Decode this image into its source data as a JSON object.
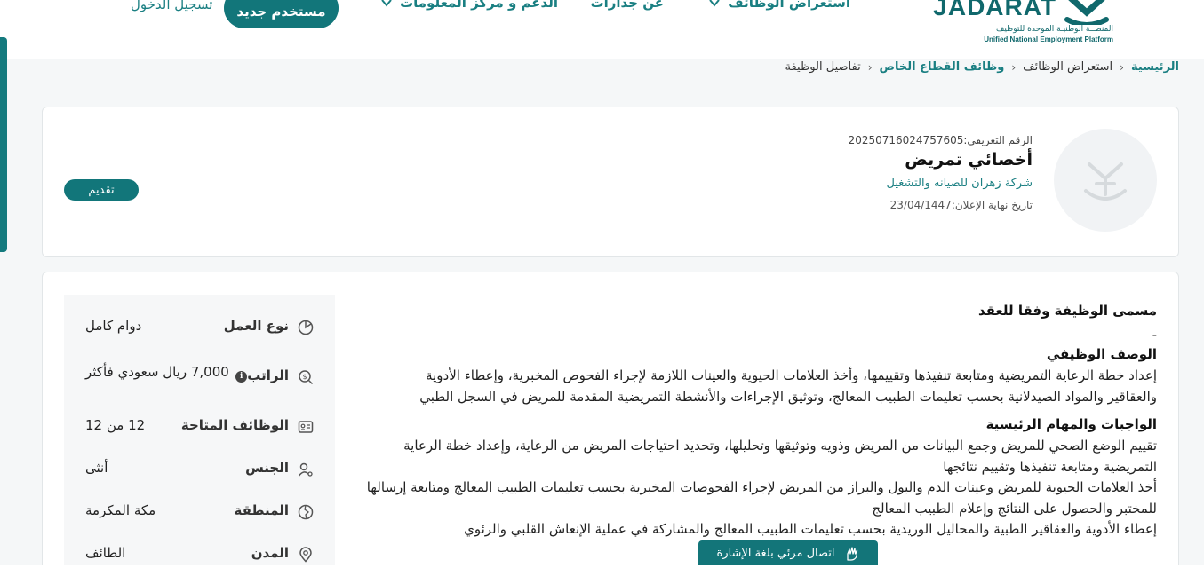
{
  "colors": {
    "primary": "#12767a",
    "link": "#1a7f82",
    "background": "#f5f7f8",
    "card": "#ffffff",
    "side_panel": "#f6f7f8"
  },
  "header": {
    "logo": {
      "word": "JADARAT",
      "arabic": "المنصــة الوطنيـة الموحدة للتوظيف",
      "english": "Unified National Employment Platform"
    },
    "nav": [
      {
        "label": "استعراض الوظائف",
        "has_dropdown": true,
        "icon": "chevron-down-icon"
      },
      {
        "label": "عن جدارات",
        "has_dropdown": false
      },
      {
        "label": "الدعم و مركز المعلومات",
        "has_dropdown": true,
        "icon": "chevron-down-icon"
      }
    ],
    "new_user_button": "مستخدم جديد",
    "login_link": "تسجيل الدخول"
  },
  "breadcrumb": [
    {
      "label": "الرئيسية",
      "link": true
    },
    {
      "label": "استعراض الوظائف",
      "link": false
    },
    {
      "label": "وظائف القطاع الخاص",
      "link": true
    },
    {
      "label": "تفاصيل الوظيفة",
      "link": false
    }
  ],
  "job": {
    "id_label": "الرقم التعريفي:",
    "id_value": "20250716024757605",
    "title": "أخصائي تمريض",
    "company": "شركة زهران للصيانه والتشغيل",
    "deadline_label": "تاريخ نهاية الإعلان:",
    "deadline_value": "23/04/1447",
    "apply_button": "تقديم",
    "logo_icon": "company-placeholder-logo-icon"
  },
  "details": {
    "contract_title_heading": "مسمى الوظيفة وفقا للعقد",
    "contract_title_value": "-",
    "job_description_heading": "الوصف الوظيفي",
    "job_description_lines": [
      "إعداد خطة الرعاية التمريضية ومتابعة تنفيذها وتقييمها، وأخذ العلامات الحيوية والعينات اللازمة لإجراء الفحوص المخبرية، وإعطاء الأدوية",
      "والعقاقير والمواد الصيدلانية بحسب تعليمات الطبيب المعالج، وتوثيق الإجراءات والأنشطة التمريضية المقدمة للمريض في السجل الطبي"
    ],
    "duties_heading": "الواجبات والمهام الرئيسية",
    "duties_lines": [
      "تقييم الوضع الصحي للمريض وجمع البيانات من المريض وذويه وتوثيقها وتحليلها، وتحديد احتياجات المريض من الرعاية، وإعداد خطة الرعاية",
      "التمريضية ومتابعة تنفيذها وتقييم نتائجها",
      "أخذ العلامات الحيوية للمريض وعينات الدم والبول والبراز من المريض لإجراء الفحوصات المخبرية بحسب تعليمات الطبيب المعالج ومتابعة إرسالها",
      "للمختبر والحصول على النتائج وإعلام الطبيب المعالج",
      "إعطاء الأدوية والعقاقير الطبية والمحاليل الوريدية بحسب تعليمات الطبيب المعالج والمشاركة في عملية الإنعاش القلبي والرئوي"
    ]
  },
  "side_info": [
    {
      "icon": "pie-chart-icon",
      "label": "نوع العمل",
      "value": "دوام كامل"
    },
    {
      "icon": "money-search-icon",
      "label": "الراتب",
      "value": "7,000 ريال سعودي فأكثر",
      "info_icon": "info-icon"
    },
    {
      "icon": "id-card-icon",
      "label": "الوظائف المتاحة",
      "value": "12  من 12"
    },
    {
      "icon": "user-gender-icon",
      "label": "الجنس",
      "value": "أنثى"
    },
    {
      "icon": "map-region-icon",
      "label": "المنطقة",
      "value": "مكة المكرمة"
    },
    {
      "icon": "location-pin-icon",
      "label": "المدن",
      "value": "الطائف"
    }
  ],
  "sign_language_bar": {
    "label": "اتصال مرئي بلغة الإشارة",
    "icon": "sign-language-hand-icon"
  }
}
